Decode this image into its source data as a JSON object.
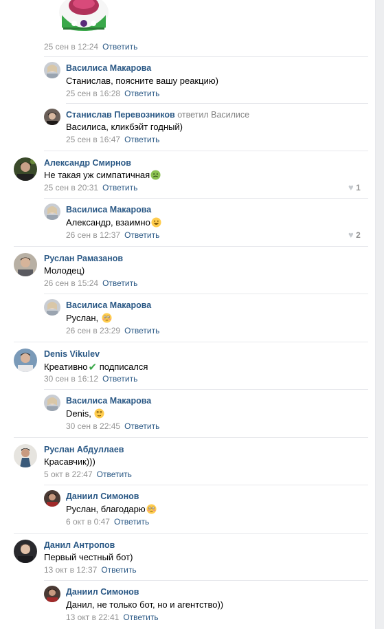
{
  "reply_label": "Ответить",
  "c0": {
    "meta": "25 сен в 12:24"
  },
  "c1": {
    "author": "Василиса Макарова",
    "text": "Станислав, поясните вашу реакцию)",
    "meta": "25 сен в 16:28"
  },
  "c2": {
    "author": "Станислав Перевозников",
    "author_suffix": "ответил Василисе",
    "text": "Василиса, кликбэйт годный)",
    "meta": "25 сен в 16:47"
  },
  "c3": {
    "author": "Александр Смирнов",
    "text": "Не такая уж симпатичная",
    "meta": "25 сен в 20:31",
    "likes": "1"
  },
  "c4": {
    "author": "Василиса Макарова",
    "text": "Александр, взаимно",
    "meta": "26 сен в 12:37",
    "likes": "2"
  },
  "c5": {
    "author": "Руслан Рамазанов",
    "text": "Молодец)",
    "meta": "26 сен в 15:24"
  },
  "c6": {
    "author": "Василиса Макарова",
    "text": "Руслан,",
    "meta": "26 сен в 23:29"
  },
  "c7": {
    "author": "Denis Vikulev",
    "text": "Креативно",
    "text2": " подписался",
    "meta": "30 сен в 16:12"
  },
  "c8": {
    "author": "Василиса Макарова",
    "text": "Denis,",
    "meta": "30 сен в 22:45"
  },
  "c9": {
    "author": "Руслан Абдуллаев",
    "text": "Красавчик)))",
    "meta": "5 окт в 22:47"
  },
  "c10": {
    "author": "Даниил Симонов",
    "text": "Руслан, благодарю",
    "meta": "6 окт в 0:47"
  },
  "c11": {
    "author": "Данил Антропов",
    "text": "Первый честный бот)",
    "meta": "13 окт в 12:37"
  },
  "c12": {
    "author": "Даниил Симонов",
    "text": "Данил, не только бот, но и агентство))",
    "meta": "13 окт в 22:41"
  },
  "icons": {
    "like": "heart-icon",
    "sticker": "sticker-image",
    "check": "checkmark-emoji"
  },
  "colors": {
    "link": "#2a5885",
    "meta": "#939393",
    "separator": "#e7e8ec"
  }
}
